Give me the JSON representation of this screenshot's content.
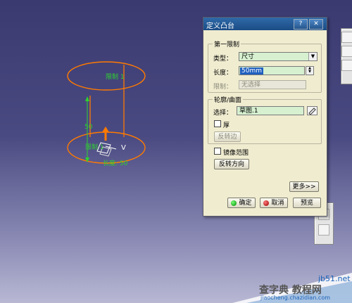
{
  "dialog": {
    "title": "定义凸台",
    "help_icon": "?",
    "close_icon": "✕",
    "first_limit": {
      "group_label": "第一限制",
      "type_label": "类型：",
      "type_value": "尺寸",
      "length_label": "长度：",
      "length_value": "50mm",
      "limit_label": "限制：",
      "limit_value": "无选择"
    },
    "profile": {
      "group_label": "轮廓/曲面",
      "select_label": "选择：",
      "select_value": "草图.1",
      "thick_label": "厚",
      "reverse_side_label": "反转边"
    },
    "mirror_label": "镜像范围",
    "reverse_direction_label": "反转方向",
    "more_label": "更多>>",
    "ok_label": "确定",
    "cancel_label": "取消",
    "preview_label": "预览"
  },
  "viewport": {
    "limit_top_label": "限制 1",
    "limit_bottom_label": "限制 1",
    "dim_label": "50",
    "length_label": "长度: 50",
    "axis_label": "V",
    "accent_color": "#ff7a00",
    "dim_color": "#2fd12f"
  },
  "watermark": {
    "site": "jb51.net",
    "brand": "查字典 教程网",
    "url": "jiaocheng.chazidian.com"
  }
}
